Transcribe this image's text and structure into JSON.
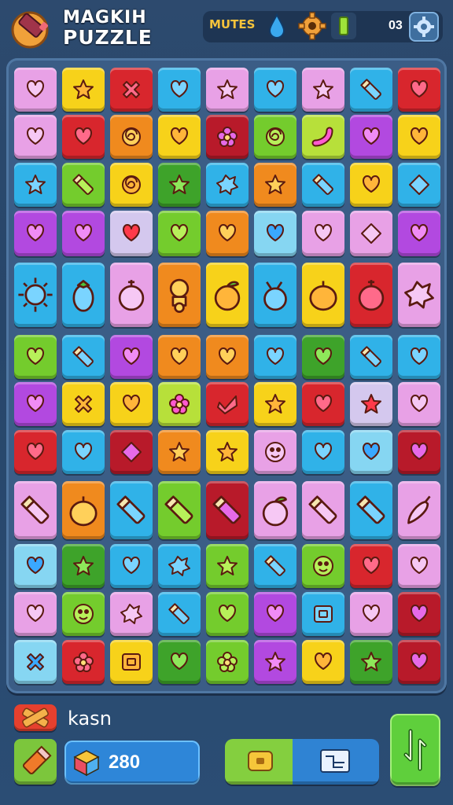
{
  "header": {
    "title_line1": "MAGKIH",
    "title_line2": "PUZZLE",
    "hud_label": "MUTES",
    "hud_value": "03"
  },
  "icons": {
    "logo": "pencil-logo-icon",
    "drop": "water-drop-icon",
    "gear": "gear-icon",
    "battery": "battery-icon",
    "settings": "settings-gear-icon",
    "combo": "crossed-bandage-icon",
    "tool": "pencil-tool-icon",
    "score": "cube-icon",
    "coin": "coin-icon",
    "map": "map-icon",
    "next": "arrow-icon"
  },
  "colors": {
    "pink": "#e8a1e6",
    "yellow": "#f7d21a",
    "red": "#d8262d",
    "blue": "#30b2e8",
    "purple": "#b249e0",
    "green": "#74cc2d",
    "orange": "#f08a1e",
    "darkred": "#b81a2a",
    "darkgreen": "#3ea32a",
    "lavender": "#d4c8ee",
    "lightblue": "#86d6f2",
    "lime": "#b7e03a"
  },
  "board": {
    "rows": [
      [
        [
          "pink",
          "heart"
        ],
        [
          "yellow",
          "star"
        ],
        [
          "red",
          "cross"
        ],
        [
          "blue",
          "heart"
        ],
        [
          "pink",
          "star"
        ],
        [
          "blue",
          "heart"
        ],
        [
          "pink",
          "star"
        ],
        [
          "blue",
          "pencil"
        ],
        [
          "red",
          "heart"
        ]
      ],
      [
        [
          "pink",
          "heart"
        ],
        [
          "red",
          "heart"
        ],
        [
          "orange",
          "swirl"
        ],
        [
          "yellow",
          "heart"
        ],
        [
          "darkred",
          "flower"
        ],
        [
          "green",
          "swirl"
        ],
        [
          "lime",
          "worm"
        ],
        [
          "purple",
          "heart"
        ],
        [
          "yellow",
          "heart"
        ]
      ],
      [
        [
          "blue",
          "star"
        ],
        [
          "green",
          "pencil"
        ],
        [
          "yellow",
          "swirl"
        ],
        [
          "darkgreen",
          "star"
        ],
        [
          "blue",
          "splat"
        ],
        [
          "orange",
          "star"
        ],
        [
          "blue",
          "pencil"
        ],
        [
          "yellow",
          "heart"
        ],
        [
          "blue",
          "diamond"
        ]
      ],
      [
        [
          "purple",
          "heart"
        ],
        [
          "purple",
          "heart"
        ],
        [
          "lavender",
          "heart"
        ],
        [
          "green",
          "heart"
        ],
        [
          "orange",
          "heart"
        ],
        [
          "lightblue",
          "heart"
        ],
        [
          "pink",
          "heart"
        ],
        [
          "pink",
          "diamond"
        ],
        [
          "purple",
          "heart"
        ]
      ],
      [
        [
          "blue",
          "sun"
        ],
        [
          "blue",
          "eggplant"
        ],
        [
          "pink",
          "fruit"
        ],
        [
          "orange",
          "mushroom"
        ],
        [
          "yellow",
          "apple"
        ],
        [
          "blue",
          "berry"
        ],
        [
          "yellow",
          "lemon"
        ],
        [
          "red",
          "fruit"
        ],
        [
          "pink",
          "splat"
        ]
      ],
      [
        [
          "green",
          "heart"
        ],
        [
          "blue",
          "pencil"
        ],
        [
          "purple",
          "heart"
        ],
        [
          "orange",
          "heart"
        ],
        [
          "orange",
          "heart"
        ],
        [
          "blue",
          "heart"
        ],
        [
          "darkgreen",
          "heart"
        ],
        [
          "blue",
          "pencil"
        ],
        [
          "blue",
          "heart"
        ]
      ],
      [
        [
          "purple",
          "heart"
        ],
        [
          "yellow",
          "cross"
        ],
        [
          "yellow",
          "heart"
        ],
        [
          "lime",
          "flower"
        ],
        [
          "red",
          "check"
        ],
        [
          "yellow",
          "star"
        ],
        [
          "red",
          "heart"
        ],
        [
          "lavender",
          "star"
        ],
        [
          "pink",
          "heart"
        ]
      ],
      [
        [
          "red",
          "heart"
        ],
        [
          "blue",
          "heart"
        ],
        [
          "darkred",
          "diamond"
        ],
        [
          "orange",
          "star"
        ],
        [
          "yellow",
          "star"
        ],
        [
          "pink",
          "face"
        ],
        [
          "blue",
          "heart"
        ],
        [
          "lightblue",
          "heart"
        ],
        [
          "darkred",
          "heart"
        ]
      ],
      [
        [
          "pink",
          "pencil"
        ],
        [
          "orange",
          "lemon"
        ],
        [
          "blue",
          "pencil"
        ],
        [
          "green",
          "pencil"
        ],
        [
          "darkred",
          "pencil"
        ],
        [
          "pink",
          "apple"
        ],
        [
          "pink",
          "pencil"
        ],
        [
          "blue",
          "pencil"
        ],
        [
          "pink",
          "pepper"
        ]
      ],
      [
        [
          "lightblue",
          "heart"
        ],
        [
          "darkgreen",
          "star"
        ],
        [
          "blue",
          "heart"
        ],
        [
          "blue",
          "splat"
        ],
        [
          "green",
          "star"
        ],
        [
          "blue",
          "pencil"
        ],
        [
          "green",
          "face"
        ],
        [
          "red",
          "heart"
        ],
        [
          "pink",
          "heart"
        ]
      ],
      [
        [
          "pink",
          "heart"
        ],
        [
          "green",
          "face"
        ],
        [
          "pink",
          "splat"
        ],
        [
          "blue",
          "pencil"
        ],
        [
          "green",
          "heart"
        ],
        [
          "purple",
          "heart"
        ],
        [
          "blue",
          "box"
        ],
        [
          "pink",
          "heart"
        ],
        [
          "darkred",
          "heart"
        ]
      ],
      [
        [
          "lightblue",
          "cross"
        ],
        [
          "red",
          "flower"
        ],
        [
          "yellow",
          "box"
        ],
        [
          "darkgreen",
          "heart"
        ],
        [
          "green",
          "flower"
        ],
        [
          "purple",
          "star"
        ],
        [
          "yellow",
          "heart"
        ],
        [
          "darkgreen",
          "star"
        ],
        [
          "darkred",
          "heart"
        ]
      ]
    ]
  },
  "bottom": {
    "combo_label": "kasn",
    "score": "280"
  }
}
